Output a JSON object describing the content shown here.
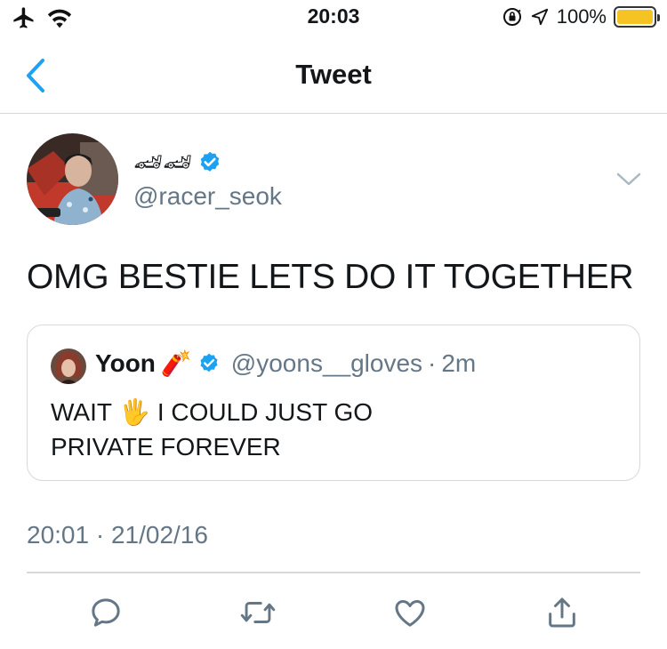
{
  "status_bar": {
    "time": "20:03",
    "battery_text": "100%",
    "battery_level": 1.0,
    "icons": [
      "airplane-icon",
      "wifi-icon",
      "orientation-lock-icon",
      "location-icon",
      "battery-icon"
    ]
  },
  "nav": {
    "title": "Tweet",
    "back_icon": "chevron-left-icon"
  },
  "tweet": {
    "display_name_emoji": "🏎🏎",
    "verified": true,
    "handle": "@racer_seok",
    "text": "OMG BESTIE LETS DO IT TOGETHER",
    "timestamp": "20:01 · 21/02/16",
    "menu_icon": "chevron-down-icon"
  },
  "quoted_tweet": {
    "name": "Yoon",
    "name_emoji": "🧨",
    "verified": true,
    "handle": "@yoons__gloves",
    "separator": "·",
    "time": "2m",
    "text_line1_a": "WAIT",
    "text_emoji": "🖐",
    "text_line1_b": "I COULD JUST GO",
    "text_line2": "PRIVATE FOREVER"
  },
  "actions": [
    "reply-icon",
    "retweet-icon",
    "like-icon",
    "share-icon"
  ],
  "colors": {
    "accent": "#1da1f2",
    "text": "#14171a",
    "secondary": "#657786",
    "border": "#d6d9db",
    "battery": "#f5c323"
  }
}
